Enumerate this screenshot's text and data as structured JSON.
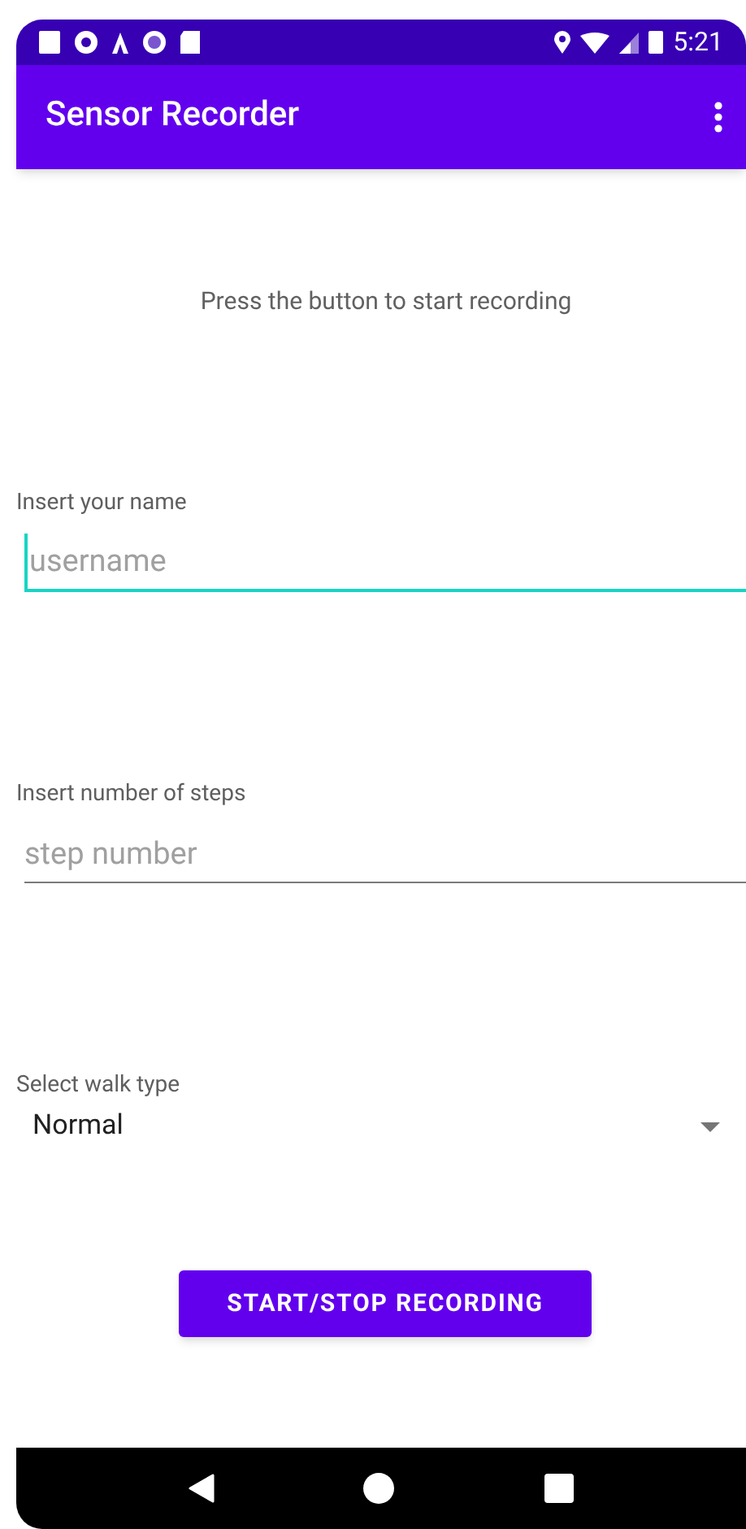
{
  "status_bar": {
    "time": "5:21"
  },
  "app_bar": {
    "title": "Sensor Recorder"
  },
  "message": "Press the button to start recording",
  "fields": [
    {
      "label": "Insert your name",
      "placeholder": "username",
      "focused": true
    },
    {
      "label": "Insert number of steps",
      "placeholder": "step number",
      "focused": false
    }
  ],
  "walk_type": {
    "label": "Select walk type",
    "value": "Normal"
  },
  "button": {
    "label": "START/STOP RECORDING"
  }
}
